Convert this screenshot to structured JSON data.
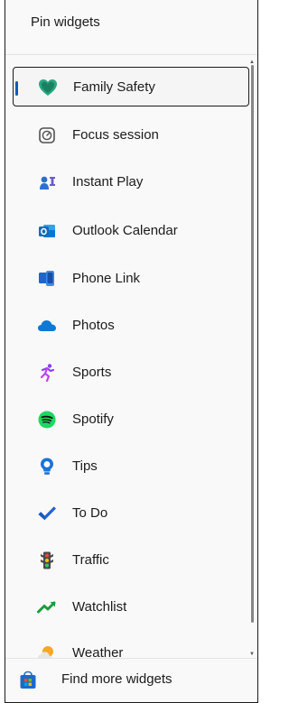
{
  "header": {
    "title": "Pin widgets"
  },
  "widgets": [
    {
      "label": "Family Safety",
      "icon": "heart-shield-icon",
      "selected": true
    },
    {
      "label": "Focus session",
      "icon": "clock-icon"
    },
    {
      "label": "Instant Play",
      "icon": "game-pieces-icon"
    },
    {
      "label": "Outlook Calendar",
      "icon": "outlook-icon"
    },
    {
      "label": "Phone Link",
      "icon": "phone-link-icon"
    },
    {
      "label": "Photos",
      "icon": "cloud-photos-icon"
    },
    {
      "label": "Sports",
      "icon": "runner-icon"
    },
    {
      "label": "Spotify",
      "icon": "spotify-icon"
    },
    {
      "label": "Tips",
      "icon": "lightbulb-icon"
    },
    {
      "label": "To Do",
      "icon": "checkmark-icon"
    },
    {
      "label": "Traffic",
      "icon": "traffic-light-icon"
    },
    {
      "label": "Watchlist",
      "icon": "trend-chart-icon"
    },
    {
      "label": "Weather",
      "icon": "sun-cloud-icon"
    }
  ],
  "footer": {
    "label": "Find more widgets",
    "icon": "store-icon"
  },
  "colors": {
    "accent": "#005fb8",
    "family_safety": "#2aa67f",
    "outlook": "#0f6cbd",
    "spotify": "#1ed760",
    "todo": "#2564cf",
    "watchlist": "#1b9c3d"
  }
}
